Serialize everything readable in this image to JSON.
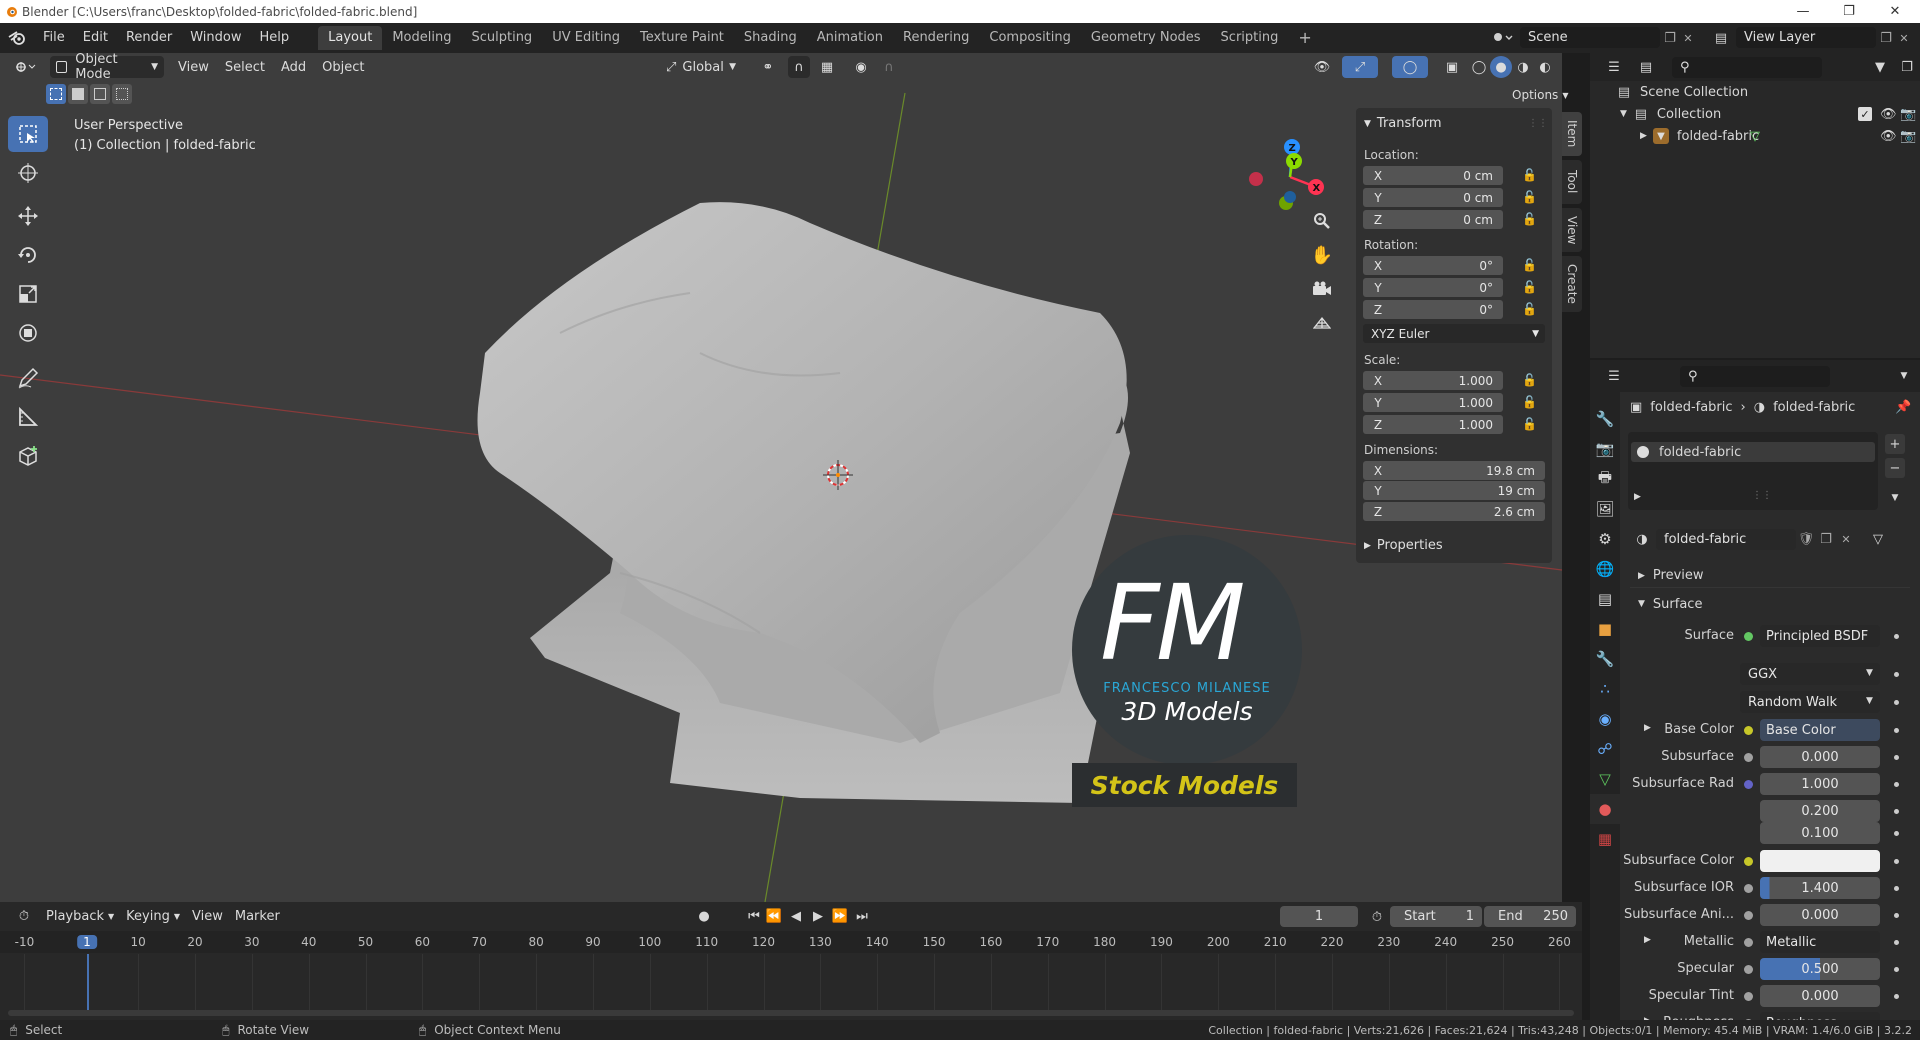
{
  "window": {
    "title": "Blender [C:\\Users\\franc\\Desktop\\folded-fabric\\folded-fabric.blend]"
  },
  "menu": [
    "File",
    "Edit",
    "Render",
    "Window",
    "Help"
  ],
  "workspaces": [
    "Layout",
    "Modeling",
    "Sculpting",
    "UV Editing",
    "Texture Paint",
    "Shading",
    "Animation",
    "Rendering",
    "Compositing",
    "Geometry Nodes",
    "Scripting"
  ],
  "active_workspace": "Layout",
  "scene": {
    "name": "Scene",
    "view_layer": "View Layer"
  },
  "viewport_header": {
    "mode": "Object Mode",
    "items": [
      "View",
      "Select",
      "Add",
      "Object"
    ],
    "orientation": "Global",
    "options": "Options"
  },
  "viewport": {
    "perspective": "User Perspective",
    "collection_info": "(1) Collection | folded-fabric",
    "watermark": {
      "initials": "FM",
      "name": "FRANCESCO MILANESE",
      "subtitle": "3D Models",
      "banner": "Stock Models"
    }
  },
  "transform": {
    "title": "Transform",
    "location_label": "Location:",
    "location": [
      {
        "axis": "X",
        "value": "0 cm"
      },
      {
        "axis": "Y",
        "value": "0 cm"
      },
      {
        "axis": "Z",
        "value": "0 cm"
      }
    ],
    "rotation_label": "Rotation:",
    "rotation": [
      {
        "axis": "X",
        "value": "0°"
      },
      {
        "axis": "Y",
        "value": "0°"
      },
      {
        "axis": "Z",
        "value": "0°"
      }
    ],
    "rotation_mode": "XYZ Euler",
    "scale_label": "Scale:",
    "scale": [
      {
        "axis": "X",
        "value": "1.000"
      },
      {
        "axis": "Y",
        "value": "1.000"
      },
      {
        "axis": "Z",
        "value": "1.000"
      }
    ],
    "dimensions_label": "Dimensions:",
    "dimensions": [
      {
        "axis": "X",
        "value": "19.8 cm"
      },
      {
        "axis": "Y",
        "value": "19 cm"
      },
      {
        "axis": "Z",
        "value": "2.6 cm"
      }
    ],
    "properties_label": "Properties"
  },
  "sidebar_tabs": [
    "Item",
    "Tool",
    "View",
    "Create"
  ],
  "outliner": {
    "scene_collection": "Scene Collection",
    "collection": "Collection",
    "object": "folded-fabric"
  },
  "properties": {
    "breadcrumb_object": "folded-fabric",
    "breadcrumb_material": "folded-fabric",
    "slot": "folded-fabric",
    "material_name": "folded-fabric",
    "preview_label": "Preview",
    "surface_panel": "Surface",
    "rows": [
      {
        "label": "Surface",
        "value": "Principled BSDF",
        "socket": "#63c763",
        "kind": "link"
      },
      {
        "label": "",
        "value": "GGX",
        "kind": "dropdown"
      },
      {
        "label": "",
        "value": "Random Walk",
        "kind": "dropdown"
      },
      {
        "label": "Base Color",
        "value": "Base Color",
        "socket": "#c7c729",
        "kind": "link",
        "expand": true
      },
      {
        "label": "Subsurface",
        "value": "0.000",
        "socket": "#a1a1a1",
        "kind": "num"
      },
      {
        "label": "Subsurface Rad",
        "value": "1.000",
        "socket": "#6363c7",
        "kind": "num"
      },
      {
        "label": "",
        "value": "0.200",
        "kind": "num"
      },
      {
        "label": "",
        "value": "0.100",
        "kind": "num"
      },
      {
        "label": "Subsurface Color",
        "value": "",
        "socket": "#c7c729",
        "kind": "color"
      },
      {
        "label": "Subsurface IOR",
        "value": "1.400",
        "socket": "#a1a1a1",
        "kind": "bar",
        "fill": 0.08
      },
      {
        "label": "Subsurface Ani...",
        "value": "0.000",
        "socket": "#a1a1a1",
        "kind": "num"
      },
      {
        "label": "Metallic",
        "value": "Metallic",
        "socket": "#a1a1a1",
        "kind": "link",
        "expand": true
      },
      {
        "label": "Specular",
        "value": "0.500",
        "socket": "#a1a1a1",
        "kind": "bar",
        "fill": 0.5
      },
      {
        "label": "Specular Tint",
        "value": "0.000",
        "socket": "#a1a1a1",
        "kind": "num"
      },
      {
        "label": "Roughness",
        "value": "Roughness",
        "socket": "#a1a1a1",
        "kind": "link",
        "expand": true
      }
    ]
  },
  "timeline": {
    "menus": [
      "Playback",
      "Keying",
      "View",
      "Marker"
    ],
    "current_frame": "1",
    "start_label": "Start",
    "start": "1",
    "end_label": "End",
    "end": "250",
    "ticks": [
      "-10",
      "1",
      "10",
      "20",
      "30",
      "40",
      "50",
      "60",
      "70",
      "80",
      "90",
      "100",
      "110",
      "120",
      "130",
      "140",
      "150",
      "160",
      "170",
      "180",
      "190",
      "200",
      "210",
      "220",
      "230",
      "240",
      "250",
      "260"
    ]
  },
  "status": {
    "select": "Select",
    "rotate": "Rotate View",
    "context": "Object Context Menu",
    "stats": "Collection | folded-fabric | Verts:21,626 | Faces:21,624 | Tris:43,248 | Objects:0/1 | Memory: 45.4 MiB | VRAM: 1.4/6.0 GiB | 3.2.2"
  },
  "colors": {
    "accent": "#4772b3",
    "x_axis": "#ff3352",
    "y_axis": "#8bdc00",
    "z_axis": "#2890ff",
    "banner_text": "#d4c418"
  }
}
